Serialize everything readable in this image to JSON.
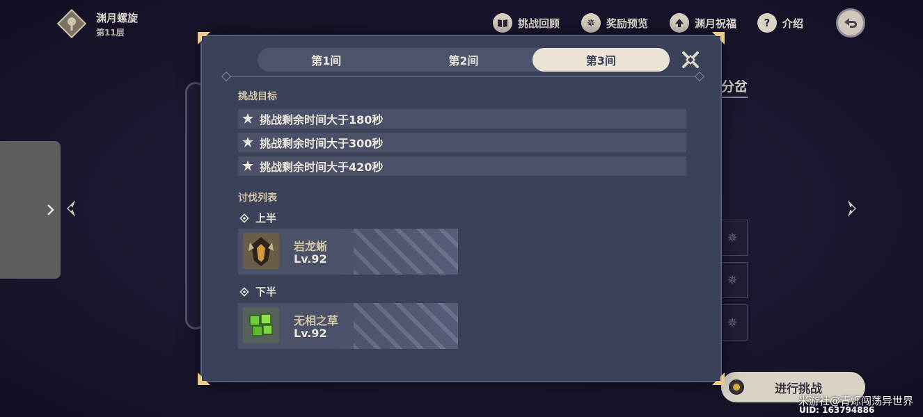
{
  "floor": {
    "title": "渊月螺旋",
    "subtitle": "第11层"
  },
  "top_nav": [
    {
      "label": "挑战回顾",
      "icon": "book-icon"
    },
    {
      "label": "奖励预览",
      "icon": "star-badge-icon"
    },
    {
      "label": "渊月祝福",
      "icon": "blessing-up-icon"
    },
    {
      "label": "介绍",
      "icon": "question-icon"
    }
  ],
  "background": {
    "right_label": "分岔"
  },
  "modal": {
    "tabs": [
      {
        "label": "第1间",
        "active": false
      },
      {
        "label": "第2间",
        "active": false
      },
      {
        "label": "第3间",
        "active": true
      }
    ],
    "objectives_title": "挑战目标",
    "objectives": [
      "挑战剩余时间大于180秒",
      "挑战剩余时间大于300秒",
      "挑战剩余时间大于420秒"
    ],
    "enemies_title": "讨伐列表",
    "halves": [
      {
        "label": "上半",
        "enemy": {
          "name": "岩龙蜥",
          "level": "Lv.92"
        }
      },
      {
        "label": "下半",
        "enemy": {
          "name": "无相之草",
          "level": "Lv.92"
        }
      }
    ]
  },
  "start_button": {
    "label": "进行挑战"
  },
  "watermark": "米游社@青烁闯荡异世界",
  "uid": "UID: 163794886",
  "colors": {
    "modal_bg": "#3b4159",
    "accent_gold": "#d2c6a6",
    "active_tab": "#ece5d7"
  }
}
